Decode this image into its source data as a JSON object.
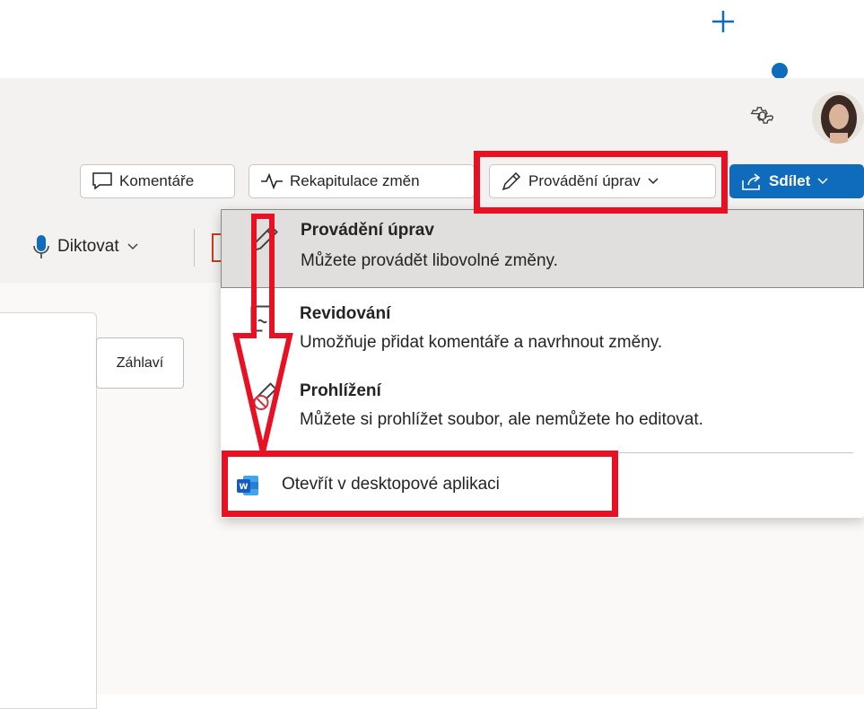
{
  "header": {
    "comments_label": "Komentáře",
    "changes_label": "Rekapitulace změn",
    "mode_label": "Provádění úprav",
    "share_label": "Sdílet"
  },
  "ribbon": {
    "dictate_label": "Diktovat"
  },
  "document": {
    "header_button_label": "Záhlaví"
  },
  "mode_menu": {
    "items": [
      {
        "title": "Provádění úprav",
        "description": "Můžete provádět libovolné změny."
      },
      {
        "title": "Revidování",
        "description": "Umožňuje přidat komentáře a navrhnout změny."
      },
      {
        "title": "Prohlížení",
        "description": "Můžete si prohlížet soubor, ale nemůžete ho editovat."
      }
    ],
    "open_desktop_label": "Otevřít v desktopové aplikaci"
  },
  "colors": {
    "accent": "#0f6cbd",
    "highlight": "#e81123",
    "word_blue": "#185abd"
  }
}
